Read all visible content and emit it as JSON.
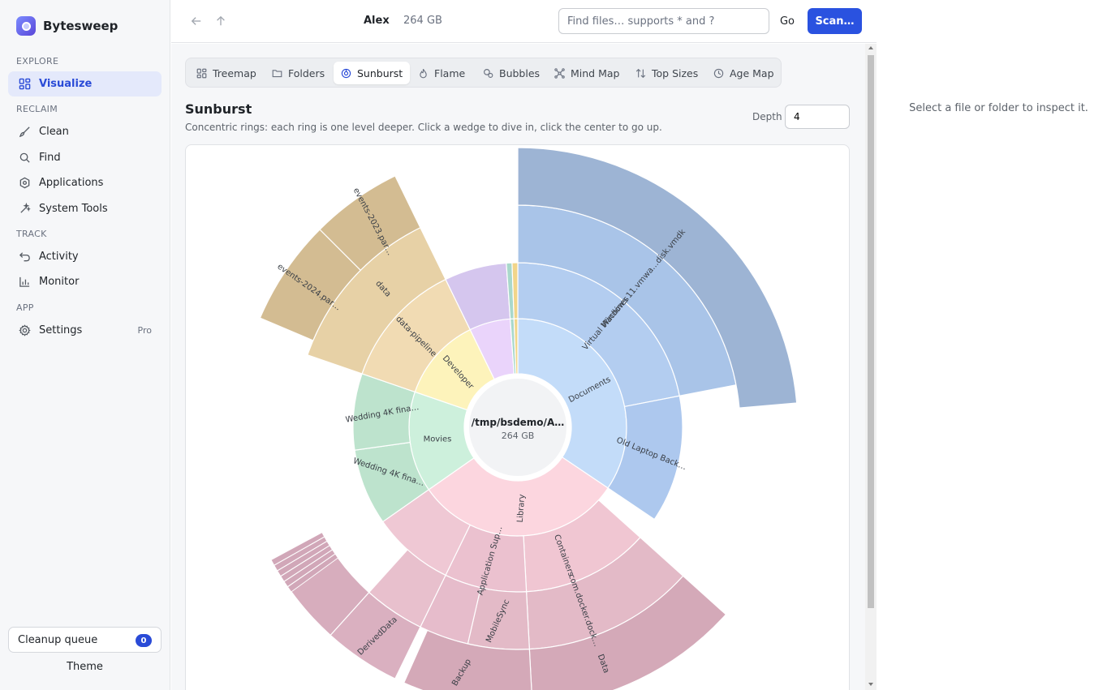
{
  "app": {
    "name": "Bytesweep"
  },
  "sidebar": {
    "sections": {
      "explore": "EXPLORE",
      "reclaim": "RECLAIM",
      "track": "TRACK",
      "app": "APP"
    },
    "items": {
      "visualize": "Visualize",
      "clean": "Clean",
      "find": "Find",
      "applications": "Applications",
      "system_tools": "System Tools",
      "activity": "Activity",
      "monitor": "Monitor",
      "settings": "Settings",
      "settings_badge": "Pro"
    },
    "queue": {
      "label": "Cleanup queue",
      "count": "0"
    },
    "theme_label": "Theme"
  },
  "topbar": {
    "location_name": "Alex",
    "location_size": "264 GB",
    "search_placeholder": "Find files… supports * and ?",
    "go_label": "Go",
    "scan_label": "Scan…"
  },
  "tabs": [
    {
      "label": "Treemap",
      "icon": "treemap-icon"
    },
    {
      "label": "Folders",
      "icon": "folder-icon"
    },
    {
      "label": "Sunburst",
      "icon": "sunburst-icon",
      "active": true
    },
    {
      "label": "Flame",
      "icon": "flame-icon"
    },
    {
      "label": "Bubbles",
      "icon": "bubbles-icon"
    },
    {
      "label": "Mind Map",
      "icon": "mind-map-icon"
    },
    {
      "label": "Top Sizes",
      "icon": "sort-icon"
    },
    {
      "label": "Age Map",
      "icon": "clock-icon"
    }
  ],
  "view": {
    "title": "Sunburst",
    "description": "Concentric rings: each ring is one level deeper. Click a wedge to dive in, click the center to go up.",
    "depth_label": "Depth",
    "depth_value": "4"
  },
  "sunburst": {
    "center_path": "/tmp/bsdemo/A…",
    "center_size": "264 GB",
    "labels": {
      "documents": "Documents",
      "virtual_machines": "Virtual Machines",
      "windows_vmdk": "Windows 11.vmwa…disk.vmdk",
      "old_laptop": "Old Laptop Back…",
      "library": "Library",
      "containers": "Containers",
      "docker": "com.docker.dock…",
      "data": "Data",
      "app_support": "Application Sup…",
      "mobilesync": "MobileSync",
      "backup": "Backup",
      "deriveddata": "DerivedData",
      "movies": "Movies",
      "wedding1": "Wedding 4K fina…",
      "wedding2": "Wedding 4K fina…",
      "developer": "Developer",
      "data_pipeline": "data-pipeline",
      "data_folder": "data",
      "events_2024": "events-2024.par…",
      "events_2023": "events-2023.par…"
    },
    "colors": {
      "documents": "#c3dcf9",
      "library": "#fcd6df",
      "movies": "#cdf0dc",
      "developer": "#fdf3bb",
      "misc": "#ead4fb",
      "center": "#f2f3f5"
    }
  },
  "inspector": {
    "empty_text": "Select a file or folder to inspect it."
  }
}
